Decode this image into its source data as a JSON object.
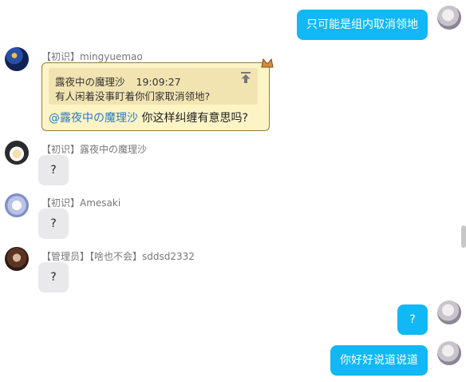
{
  "messages": {
    "self_1": {
      "text": "只可能是组内取消领地"
    },
    "ming": {
      "sender": "【初识】mingyuemao",
      "quote_author": "露夜中の魔理沙",
      "quote_time": "19:09:27",
      "quote_text": "有人闲着没事盯着你们家取消领地?",
      "mention": "@露夜中の魔理沙",
      "reply_text": " 你这样纠缠有意思吗?"
    },
    "marisa": {
      "sender": "【初识】露夜中の魔理沙",
      "text": "?"
    },
    "amesaki": {
      "sender": "【初识】Amesaki",
      "text": "?"
    },
    "sdd": {
      "sender": "【管理员】【啥也不会】sddsd2332",
      "text": "?"
    },
    "self_2": {
      "text": "?"
    },
    "self_3": {
      "text": "你好好说道说道"
    }
  },
  "icons": {
    "jump_to_quote": "arrow-up-to-top-icon",
    "card_decoration": "cat-ear-icon"
  },
  "colors": {
    "self_bubble": "#12b7f5",
    "other_bubble": "#e9e9eb",
    "reply_card_bg": "#fdf4c6",
    "mention": "#2a79c8"
  }
}
